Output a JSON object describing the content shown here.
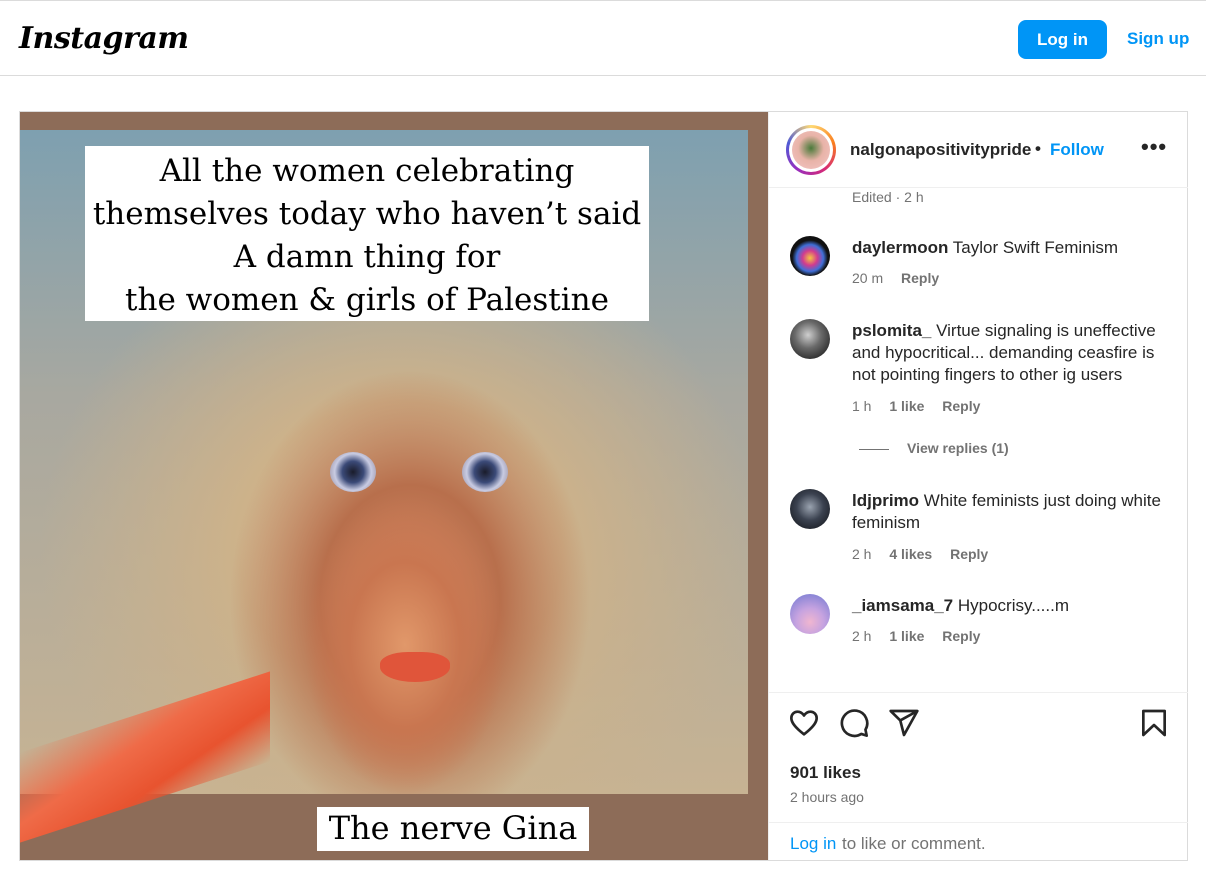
{
  "topbar": {
    "logo": "Instagram",
    "login_label": "Log in",
    "signup_label": "Sign up"
  },
  "media": {
    "caption_lines": [
      "All the women celebrating",
      "themselves today who haven’t said",
      "A damn thing for",
      "the women & girls of Palestine"
    ],
    "bottom_caption": "The nerve Gina"
  },
  "post_header": {
    "username": "nalgonapositivitypride",
    "separator": "•",
    "follow_label": "Follow",
    "more_icon": "more-horizontal-icon"
  },
  "edited": "Edited · 2 h",
  "comments": [
    {
      "user": "daylermoon",
      "text": "Taylor Swift Feminism",
      "time": "20 m",
      "likes": "",
      "reply": "Reply"
    },
    {
      "user": "pslomita_",
      "text": "Virtue signaling is uneffective and hypocritical... demanding ceasfire is not pointing fingers to other ig users",
      "time": "1 h",
      "likes": "1 like",
      "reply": "Reply"
    },
    {
      "user": "ldjprimo",
      "text": "White feminists just doing white feminism",
      "time": "2 h",
      "likes": "4 likes",
      "reply": "Reply"
    },
    {
      "user": "_iamsama_7",
      "text": "Hypocrisy.....m",
      "time": "2 h",
      "likes": "1 like",
      "reply": "Reply"
    }
  ],
  "view_replies": "View replies (1)",
  "actions": {
    "icons": [
      "heart-icon",
      "comment-icon",
      "share-icon",
      "bookmark-icon"
    ],
    "likes": "901 likes",
    "time_ago": "2 hours ago"
  },
  "login_prompt": {
    "link": "Log in",
    "rest": "to like or comment."
  },
  "colors": {
    "accent": "#0095f6",
    "text": "#262626",
    "muted": "#737373",
    "border": "#dbdbdb"
  }
}
